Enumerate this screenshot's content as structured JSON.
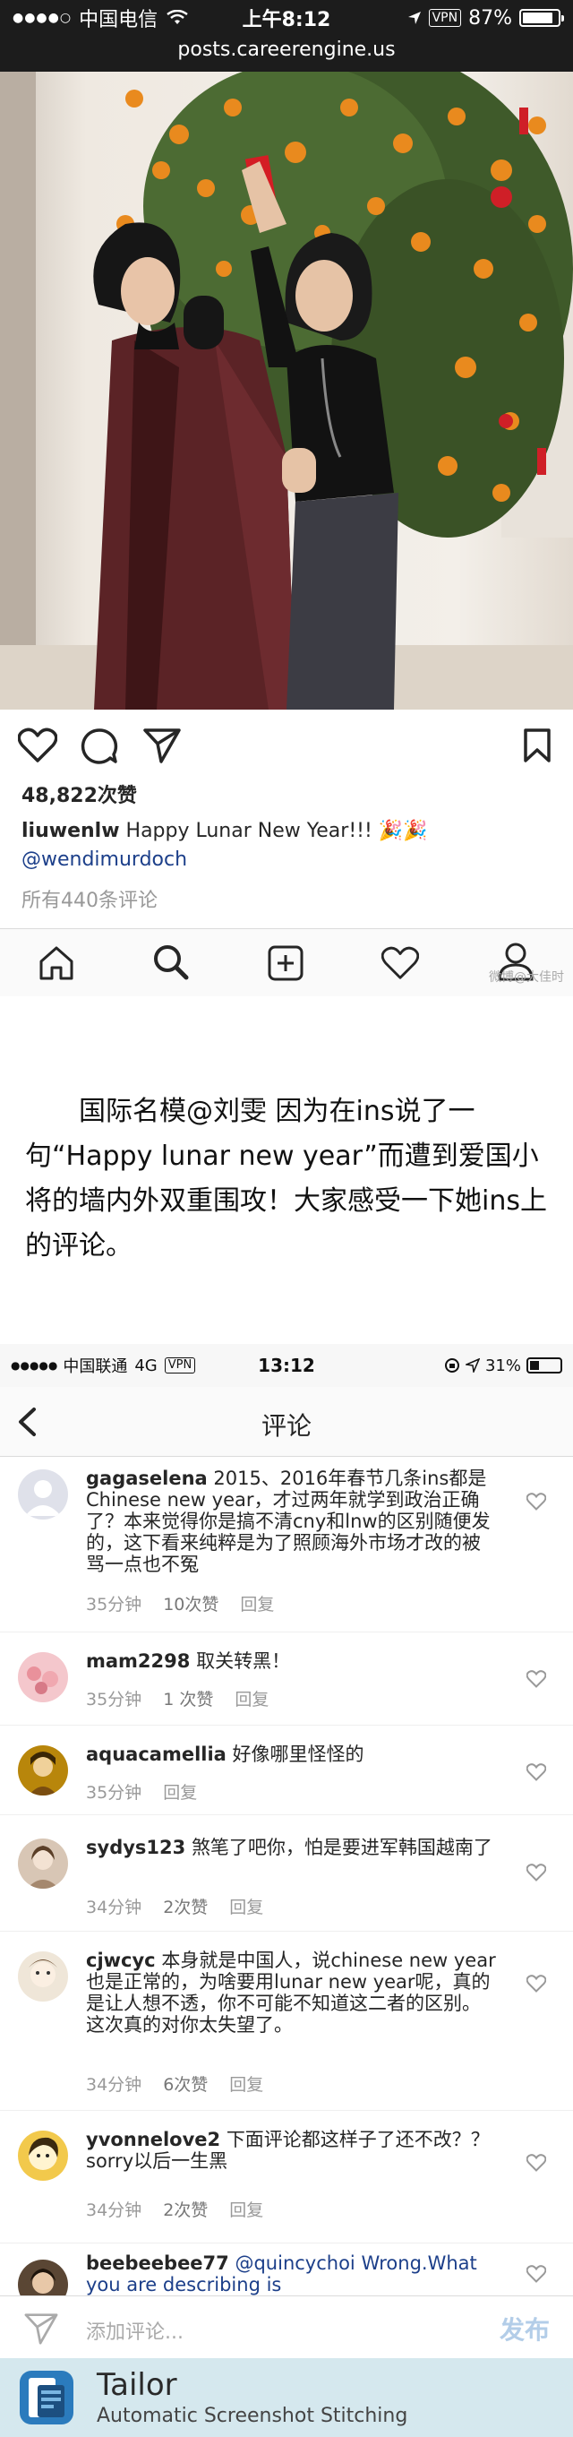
{
  "status_bar_1": {
    "carrier": "中国电信",
    "time": "上午8:12",
    "vpn": "VPN",
    "battery": "87%",
    "battery_fraction": 0.87
  },
  "browser": {
    "url": "posts.careerengine.us"
  },
  "instagram_post": {
    "likes": "48,822次赞",
    "username": "liuwenlw",
    "caption": "Happy Lunar New Year!!! 🎉🎉",
    "mention": "@wendimurdoch",
    "all_comments": "所有440条评论"
  },
  "watermark": "微博@大佳时",
  "article": {
    "text": "国际名模@刘雯 因为在ins说了一句“Happy lunar new year”而遭到爱国小将的墙内外双重围攻！大家感受一下她ins上的评论。"
  },
  "status_bar_2": {
    "carrier": "中国联通",
    "network": "4G",
    "vpn": "VPN",
    "time": "13:12",
    "battery": "31%",
    "battery_fraction": 0.31
  },
  "comments_screen": {
    "title": "评论",
    "reply_label": "回复",
    "comments": [
      {
        "user": "gagaselena",
        "text": "2015、2016年春节几条ins都是Chinese new year，才过两年就学到政治正确了？本来觉得你是搞不清cny和lnw的区别随便发的，这下看来纯粹是为了照顾海外市场才改的被骂一点也不冤",
        "time": "35分钟",
        "likes": "10次赞"
      },
      {
        "user": "mam2298",
        "text": "取关转黑！",
        "time": "35分钟",
        "likes": "1 次赞"
      },
      {
        "user": "aquacamellia",
        "text": "好像哪里怪怪的",
        "time": "35分钟",
        "likes": ""
      },
      {
        "user": "sydys123",
        "text": "煞笔了吧你，怕是要进军韩国越南了",
        "time": "34分钟",
        "likes": "2次赞"
      },
      {
        "user": "cjwcyc",
        "text": "本身就是中国人，说chinese new year也是正常的，为啥要用lunar new year呢，真的是让人想不透，你不可能不知道这二者的区别。这次真的对你太失望了。",
        "time": "34分钟",
        "likes": "6次赞"
      },
      {
        "user": "yvonnelove2",
        "text": "下面评论都这样子了还不改？？sorry以后一生黑",
        "time": "34分钟",
        "likes": "2次赞"
      },
      {
        "user": "beebeebee77",
        "text": "@quincychoi Wrong.What you are describing is",
        "time": "",
        "likes": ""
      }
    ],
    "input_placeholder": "添加评论...",
    "publish_label": "发布"
  },
  "tailor_banner": {
    "name": "Tailor",
    "tagline": "Automatic Screenshot Stitching"
  },
  "colors": {
    "dark_bar": "#1c1c1c",
    "link_blue": "#1c3f8a",
    "muted_gray": "#999999",
    "tailor_bg": "#d5e8ee"
  }
}
